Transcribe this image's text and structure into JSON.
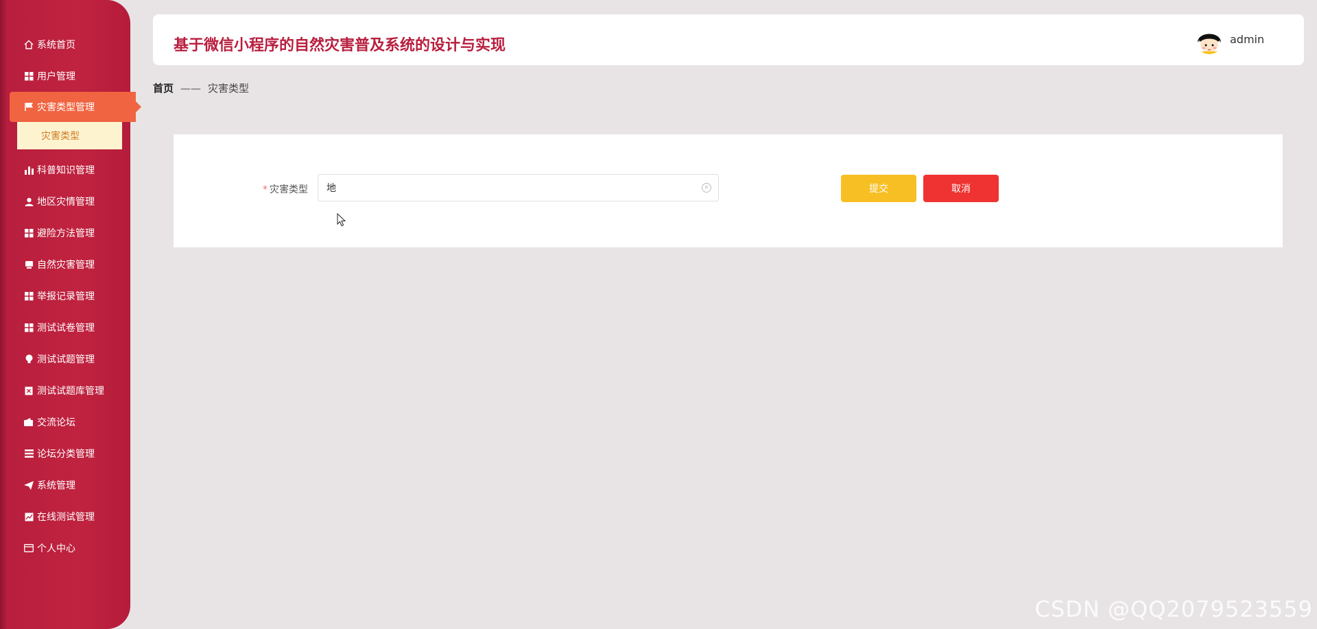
{
  "header": {
    "title": "基于微信小程序的自然灾害普及系统的设计与实现",
    "username": "admin"
  },
  "sidebar": {
    "items": [
      {
        "label": "系统首页",
        "icon": "home-icon"
      },
      {
        "label": "用户管理",
        "icon": "grid-icon"
      },
      {
        "label": "灾害类型管理",
        "icon": "flag-icon",
        "active": true
      },
      {
        "label": "科普知识管理",
        "icon": "bar-chart-icon"
      },
      {
        "label": "地区灾情管理",
        "icon": "user-icon"
      },
      {
        "label": "避险方法管理",
        "icon": "grid-icon"
      },
      {
        "label": "自然灾害管理",
        "icon": "monitor-icon"
      },
      {
        "label": "举报记录管理",
        "icon": "grid-icon"
      },
      {
        "label": "测试试卷管理",
        "icon": "grid-icon"
      },
      {
        "label": "测试试题管理",
        "icon": "bulb-icon"
      },
      {
        "label": "测试试题库管理",
        "icon": "clipboard-icon"
      },
      {
        "label": "交流论坛",
        "icon": "wallet-icon"
      },
      {
        "label": "论坛分类管理",
        "icon": "list-icon"
      },
      {
        "label": "系统管理",
        "icon": "send-icon"
      },
      {
        "label": "在线测试管理",
        "icon": "line-chart-icon"
      },
      {
        "label": "个人中心",
        "icon": "card-icon"
      }
    ],
    "submenu": {
      "label": "灾害类型"
    }
  },
  "breadcrumb": {
    "home": "首页",
    "separator": "——",
    "current": "灾害类型"
  },
  "form": {
    "label": "灾害类型",
    "required_mark": "*",
    "value": "地",
    "submit": "提交",
    "cancel": "取消"
  },
  "watermark": "CSDN @QQ2079523559",
  "colors": {
    "sidebar": "#c0233f",
    "active": "#f06442",
    "title": "#b81e3e",
    "submit": "#f7bf23",
    "cancel": "#ef3232"
  }
}
